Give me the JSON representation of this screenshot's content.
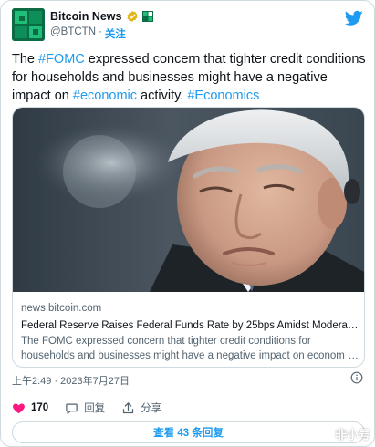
{
  "account": {
    "name": "Bitcoin News",
    "handle": "@BTCTN",
    "separator": "·",
    "follow_label": "关注"
  },
  "tweet": {
    "segments": [
      {
        "text": "The ",
        "tag": false
      },
      {
        "text": "#FOMC",
        "tag": true
      },
      {
        "text": " expressed concern that tighter credit conditions for households and businesses might have a negative impact on ",
        "tag": false
      },
      {
        "text": "#economic",
        "tag": true
      },
      {
        "text": " activity. ",
        "tag": false
      },
      {
        "text": "#Economics",
        "tag": true
      }
    ]
  },
  "link_card": {
    "domain": "news.bitcoin.com",
    "title": "Federal Reserve Raises Federal Funds Rate by 25bps Amidst Moderate E…",
    "description": "The FOMC expressed concern that tighter credit conditions for households and businesses might have a negative impact on economic",
    "description_ellipsis": "…"
  },
  "timestamp": "上午2:49 · 2023年7月27日",
  "actions": {
    "like_count": "170",
    "reply_label": "回复",
    "share_label": "分享"
  },
  "replies_button": "查看 43 条回复",
  "watermark": "非小号",
  "colors": {
    "accent": "#1d9bf0",
    "like": "#f91880",
    "text": "#0f1419",
    "muted": "#536471",
    "border": "#cfd9de",
    "verified": "#e2b719"
  },
  "icons": [
    "bitcoin-news-avatar",
    "verified-badge-icon",
    "bitcoin-news-mini-logo-icon",
    "twitter-bird-icon",
    "info-icon",
    "heart-icon",
    "reply-bubble-icon",
    "share-icon",
    "watermark-logo-icon"
  ]
}
